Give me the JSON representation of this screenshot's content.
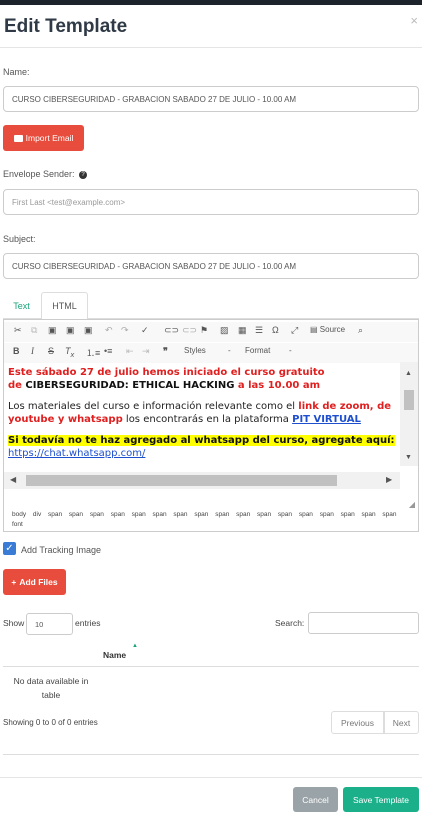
{
  "modal": {
    "title": "Edit Template",
    "close_icon": "×"
  },
  "fields": {
    "name_label": "Name:",
    "name_value": "CURSO CIBERSEGURIDAD - GRABACION SABADO 27 DE JULIO - 10.00 AM",
    "import_email_label": "Import Email",
    "sender_label": "Envelope Sender:",
    "sender_placeholder": "First Last <test@example.com>",
    "subject_label": "Subject:",
    "subject_value": "CURSO CIBERSEGURIDAD - GRABACION SABADO 27 DE JULIO - 10.00 AM"
  },
  "tabs": {
    "text": "Text",
    "html": "HTML"
  },
  "editor": {
    "toolbar": {
      "source": "Source",
      "styles": "Styles",
      "format": "Format",
      "dash": "-"
    },
    "content": {
      "l1": "Este sábado 27 de julio hemos iniciado el curso gratuito",
      "l2a": "de ",
      "l2b": "CIBERSEGURIDAD: ETHICAL HACKING",
      "l2c": " a las 10.00 am",
      "l3a": "Los materiales del curso e información relevante como el ",
      "l3b": "link de zoom, de youtube y whatsapp",
      "l3c": " los encontrarás en la plataforma ",
      "l3d": "PIT VIRTUAL",
      "l4": "Si todavía no te haz agregado al whatsapp del curso, agregate aquí:",
      "l4link": "https://chat.whatsapp.com/"
    },
    "path": "body div span span span span span span span span span span span span span span span span span font"
  },
  "tracking": {
    "label": "Add Tracking Image",
    "checked": true
  },
  "add_files": "Add Files",
  "table": {
    "show": "Show",
    "entries_value": "10",
    "entries": "entries",
    "search": "Search:",
    "column": "Name",
    "empty": "No data available in table",
    "info": "Showing 0 to 0 of 0 entries",
    "prev": "Previous",
    "next": "Next"
  },
  "footer": {
    "cancel": "Cancel",
    "save": "Save Template"
  },
  "colors": {
    "red": "#e74c3c",
    "green": "#1aa37a",
    "cancel": "#9aa3a8"
  }
}
